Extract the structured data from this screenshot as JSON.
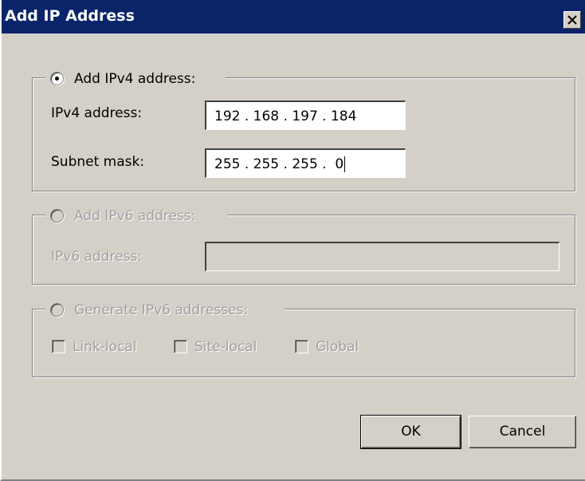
{
  "window": {
    "title": "Add IP Address"
  },
  "ipv4": {
    "radio_label": "Add IPv4 address:",
    "address_label": "IPv4 address:",
    "address_value": "192 . 168 . 197 . 184",
    "mask_label": "Subnet mask:",
    "mask_value": "255 . 255 . 255 .  0",
    "selected": true
  },
  "ipv6": {
    "radio_label": "Add IPv6 address:",
    "address_label": "IPv6 address:",
    "address_value": "",
    "enabled": false
  },
  "generate": {
    "radio_label": "Generate IPv6 addresses:",
    "options": [
      "Link-local",
      "Site-local",
      "Global"
    ],
    "enabled": false
  },
  "buttons": {
    "ok": "OK",
    "cancel": "Cancel"
  },
  "colors": {
    "title_bar": "#0a246a",
    "dialog_bg": "#d4d0c8",
    "disabled_text": "#a0a0a0"
  }
}
